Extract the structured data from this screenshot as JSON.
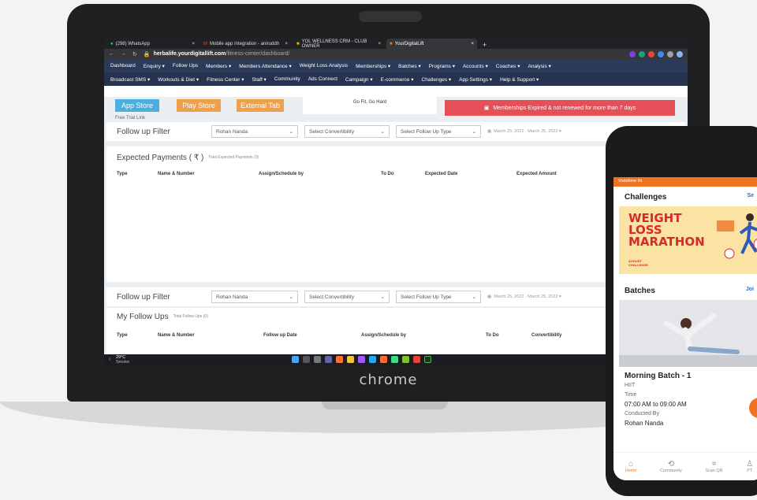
{
  "brand": "chrome",
  "browser": {
    "tabs": [
      {
        "title": "(298) WhatsApp",
        "icon": "whatsapp-icon",
        "color": "#25d366"
      },
      {
        "title": "Mobile app Integration - aniruddh",
        "icon": "gmail-icon",
        "color": "#ea4335"
      },
      {
        "title": "YOL WELLNESS CRM - CLUB OWNER",
        "icon": "slides-icon",
        "color": "#f4b400"
      },
      {
        "title": "YourDigitalLift",
        "icon": "ydl-icon",
        "color": "#f07420"
      }
    ],
    "tab_close": "×",
    "new_tab": "+",
    "url_host": "herbalife.yourdigitallift.com",
    "url_path": "/fitness-center/dashboard/"
  },
  "nav_row1": [
    "Dashboard",
    "Enquiry ▾",
    "Follow Ups",
    "Members ▾",
    "Members Attendance ▾",
    "Weight Loss Analysis",
    "Memberships ▾",
    "Batches ▾",
    "Programs ▾",
    "Accounts ▾",
    "Coaches ▾",
    "Analysis ▾"
  ],
  "nav_row2": [
    "Broadcast SMS ▾",
    "Workouts & Diet ▾",
    "Fitness Center ▾",
    "Staff ▾",
    "Community",
    "Ads Connect",
    "Campaign ▾",
    "E-commerce ▾",
    "Challenges ▾",
    "App Settings ▾",
    "Help & Support ▾"
  ],
  "dashboard": {
    "app_store": "App Store",
    "play_store": "Play Store",
    "external_tab": "External Tab",
    "trial_link": "Free Trial Link",
    "quote": "Go Fit, Go Hard",
    "expired_alert": "Memberships Expired & not renewed for more than 7 days",
    "follow_filter_label": "Follow up Filter",
    "staff_select": "Rohan Nanda",
    "convertibility_select": "Select Convertibility",
    "followup_type_select": "Select Follow Up Type",
    "date_range": "March 25, 2022 - March 25, 2022 ▾",
    "expected_payments_title": "Expected Payments ( ₹ )",
    "expected_payments_sub": "Total Expected Payments (0)",
    "expected_cols": [
      "Type",
      "Name & Number",
      "Assign/Schedule by",
      "To Do",
      "Expected Date",
      "Expected Amount"
    ],
    "my_followups_title": "My Follow Ups",
    "my_followups_sub": "Total Follow Ups (0)",
    "followup_cols": [
      "Type",
      "Name & Number",
      "Follow up Date",
      "Assign/Schedule by",
      "To Do",
      "Convertibility"
    ]
  },
  "taskbar": {
    "temp": "29°C",
    "weather": "Smoke"
  },
  "phone": {
    "carrier": "Vodafone IN",
    "challenges_title": "Challenges",
    "challenges_link": "Se",
    "banner_line1": "WEIGHT",
    "banner_line2": "LOSS",
    "banner_line3": "MARATHON",
    "banner_sub1": "AUGUST",
    "banner_sub2": "CHALLENGE",
    "batches_title": "Batches",
    "batches_link": "Joi",
    "batch_name": "Morning Batch - 1",
    "batch_type": "HIIT",
    "time_label": "Time",
    "time_value": "07:00 AM to 09:00 AM",
    "conducted_label": "Conducted By",
    "conducted_value": "Rohan Nanda",
    "nav": [
      "Home",
      "Community",
      "Scan QR",
      "PT"
    ]
  }
}
